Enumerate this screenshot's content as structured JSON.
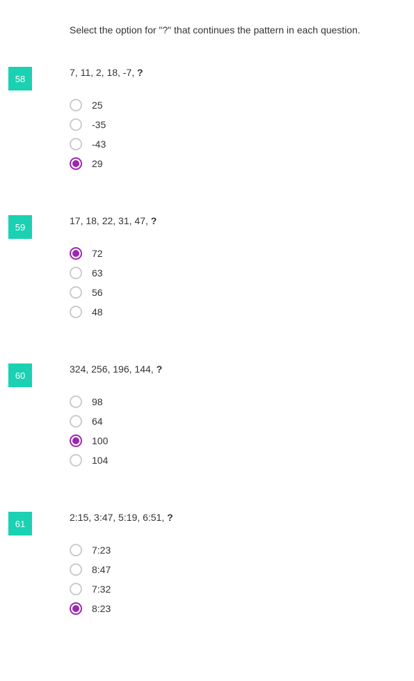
{
  "instructions": "Select the option for \"?\" that continues the pattern in each question.",
  "questions": [
    {
      "number": "58",
      "prompt_prefix": "7, 11, 2, 18, -7, ",
      "prompt_mark": "?",
      "options": [
        "25",
        "-35",
        "-43",
        "29"
      ],
      "selected": 3
    },
    {
      "number": "59",
      "prompt_prefix": "17, 18, 22, 31, 47, ",
      "prompt_mark": "?",
      "options": [
        "72",
        "63",
        "56",
        "48"
      ],
      "selected": 0
    },
    {
      "number": "60",
      "prompt_prefix": "324, 256, 196, 144, ",
      "prompt_mark": "?",
      "options": [
        "98",
        "64",
        "100",
        "104"
      ],
      "selected": 2
    },
    {
      "number": "61",
      "prompt_prefix": "2:15, 3:47, 5:19, 6:51, ",
      "prompt_mark": "?",
      "options": [
        "7:23",
        "8:47",
        "7:32",
        "8:23"
      ],
      "selected": 3
    }
  ]
}
